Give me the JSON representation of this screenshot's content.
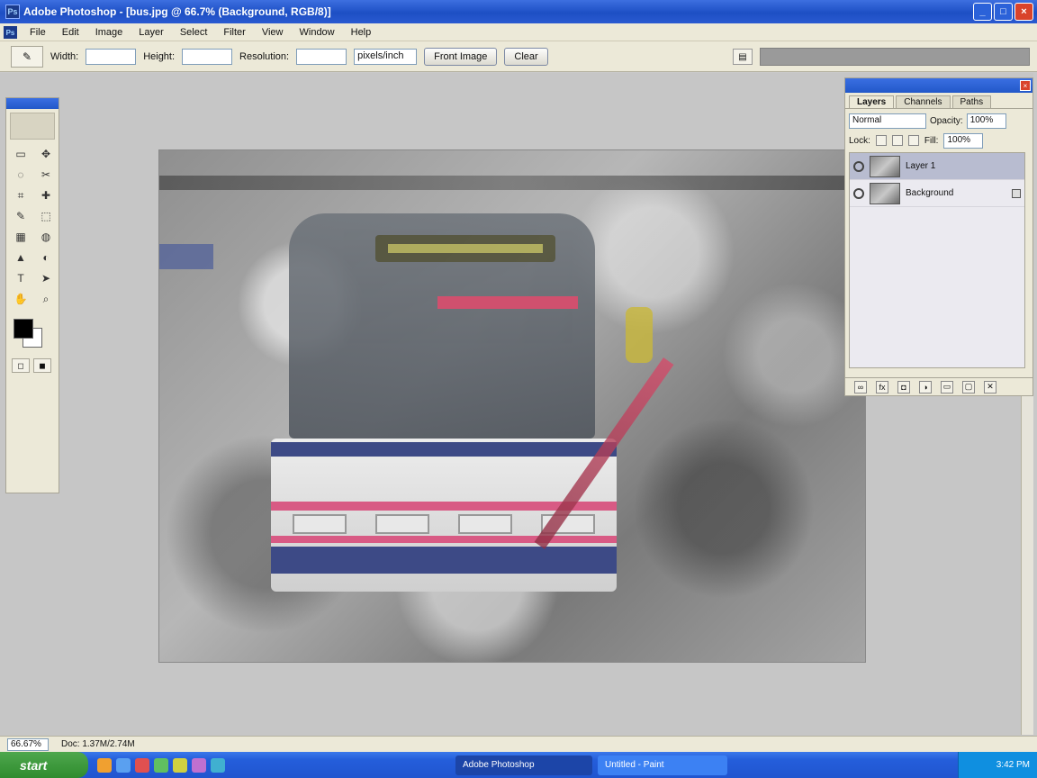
{
  "window": {
    "title": "Adobe Photoshop - [bus.jpg @ 66.7% (Background, RGB/8)]",
    "app_icon": "Ps",
    "buttons": {
      "minimize": "_",
      "maximize": "□",
      "close": "×"
    }
  },
  "menu": {
    "items": [
      "File",
      "Edit",
      "Image",
      "Layer",
      "Select",
      "Filter",
      "View",
      "Window",
      "Help"
    ]
  },
  "options": {
    "tool_icon": "✎",
    "width_label": "Width:",
    "width_value": "",
    "height_label": "Height:",
    "height_value": "",
    "resolution_label": "Resolution:",
    "resolution_value": "",
    "units_value": "pixels/inch",
    "front_image_label": "Front Image",
    "clear_label": "Clear"
  },
  "toolbox": {
    "tools": [
      "▭",
      "✥",
      "◌",
      "✂",
      "⌗",
      "✚",
      "✎",
      "⬚",
      "▦",
      "◍",
      "▲",
      "◐",
      "T",
      "➤",
      "✋",
      "⌕"
    ],
    "mode_buttons": [
      "◻",
      "◼"
    ],
    "colors": {
      "foreground": "#000000",
      "background": "#ffffff"
    }
  },
  "layers": {
    "tabs": [
      "Layers",
      "Channels",
      "Paths"
    ],
    "active_tab": "Layers",
    "blend_mode": "Normal",
    "opacity_label": "Opacity:",
    "opacity_value": "100%",
    "lock_label": "Lock:",
    "fill_label": "Fill:",
    "fill_value": "100%",
    "rows": [
      {
        "name": "Layer 1",
        "selected": true
      },
      {
        "name": "Background",
        "selected": false
      }
    ],
    "footer_icons": [
      "link-icon",
      "fx-icon",
      "mask-icon",
      "adjustment-icon",
      "folder-icon",
      "new-layer-icon",
      "trash-icon"
    ],
    "footer_glyphs": [
      "∞",
      "fx",
      "◘",
      "◑",
      "▭",
      "▢",
      "✕"
    ]
  },
  "status": {
    "zoom": "66.67%",
    "doc_info": "Doc: 1.37M/2.74M"
  },
  "taskbar": {
    "start_label": "start",
    "quicklaunch_colors": [
      "#f0a030",
      "#5aa0f0",
      "#e05050",
      "#60c060",
      "#d0d040",
      "#c070d0",
      "#40b0d0"
    ],
    "tasks": [
      {
        "label": "Adobe Photoshop",
        "active": true
      },
      {
        "label": "Untitled - Paint",
        "active": false
      }
    ],
    "clock": "3:42 PM"
  }
}
